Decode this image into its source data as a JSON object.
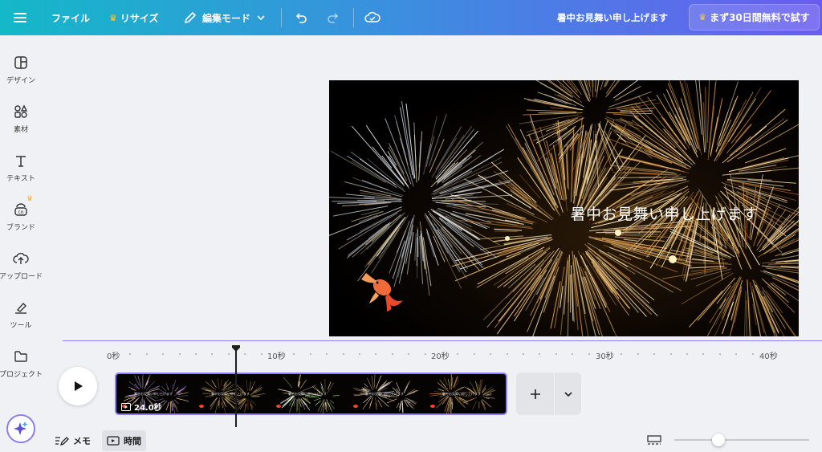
{
  "topbar": {
    "menu_icon": "hamburger-icon",
    "file_label": "ファイル",
    "resize_label": "リサイズ",
    "edit_mode_label": "編集モード",
    "doc_title": "暑中お見舞い申し上げます",
    "trial_label": "まず30日間無料で試す",
    "colors": {
      "start": "#14b8c8",
      "end": "#6a5cf0",
      "crown": "#ffc83d"
    }
  },
  "sidebar": {
    "items": [
      {
        "label": "デザイン",
        "icon": "design-layout-icon"
      },
      {
        "label": "素材",
        "icon": "elements-shapes-icon"
      },
      {
        "label": "テキスト",
        "icon": "text-t-icon"
      },
      {
        "label": "ブランド",
        "icon": "brand-icon"
      },
      {
        "label": "アップロード",
        "icon": "upload-cloud-icon"
      },
      {
        "label": "ツール",
        "icon": "draw-tool-icon"
      },
      {
        "label": "プロジェクト",
        "icon": "folder-icon"
      }
    ],
    "magic_icon": "sparkle-icon"
  },
  "canvas": {
    "title": "暑中お見舞い申し上げます",
    "accent": "#8c7df5"
  },
  "timeline": {
    "ruler": [
      "0秒",
      "10秒",
      "20秒",
      "30秒",
      "40秒"
    ],
    "clip_duration": "24.0秒",
    "clip_frame_text": "暑中お見舞い申し上げます"
  },
  "bottom": {
    "notes_label": "メモ",
    "time_label": "時間",
    "zoom_level": 0.33
  }
}
